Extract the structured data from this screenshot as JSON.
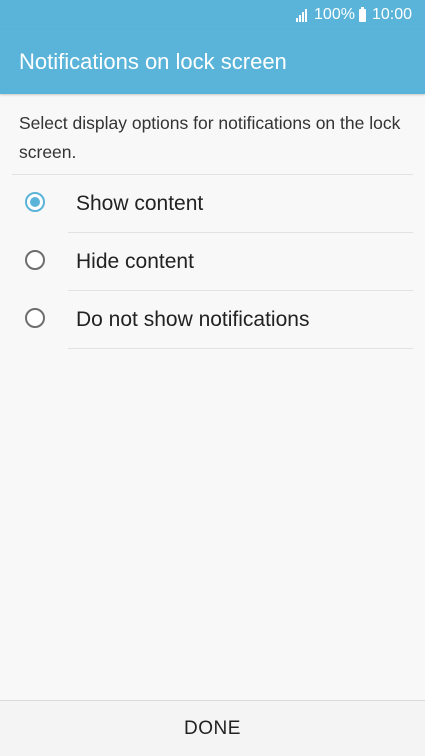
{
  "status_bar": {
    "battery_percent": "100%",
    "time": "10:00",
    "signal_icon": "signal-icon",
    "battery_icon": "battery-icon"
  },
  "header": {
    "title": "Notifications on lock screen",
    "background_color": "#5ab4d9"
  },
  "description": "Select display options for notifications on the lock screen.",
  "options": [
    {
      "label": "Show content",
      "selected": true
    },
    {
      "label": "Hide content",
      "selected": false
    },
    {
      "label": "Do not show notifications",
      "selected": false
    }
  ],
  "footer": {
    "done_label": "DONE"
  },
  "colors": {
    "accent": "#5ab4d9"
  }
}
